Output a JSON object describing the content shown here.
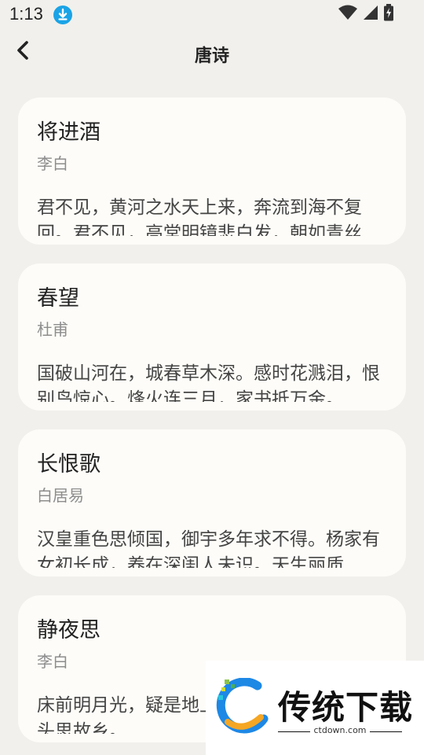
{
  "status_bar": {
    "time": "1:13",
    "icons": [
      "download-icon",
      "wifi-icon",
      "signal-icon",
      "battery-charging-icon"
    ],
    "colors": {
      "download": "#1aa3e6"
    }
  },
  "header": {
    "title": "唐诗",
    "back_icon": "chevron-left-icon"
  },
  "poems": [
    {
      "title": "将进酒",
      "author": "李白",
      "excerpt": "君不见，黄河之水天上来，奔流到海不复回。君不见，高堂明镜悲白发，朝如青丝"
    },
    {
      "title": "春望",
      "author": "杜甫",
      "excerpt": "国破山河在，城春草木深。感时花溅泪，恨别鸟惊心。烽火连三月，家书抵万金。"
    },
    {
      "title": "长恨歌",
      "author": "白居易",
      "excerpt": "汉皇重色思倾国，御宇多年求不得。杨家有女初长成，养在深闺人未识。天生丽质"
    },
    {
      "title": "静夜思",
      "author": "李白",
      "excerpt": "床前明月光，疑是地上霜。举头望明月，低头思故乡。"
    }
  ],
  "watermark": {
    "name": "传统下载",
    "url": "ctdown.com"
  },
  "colors": {
    "background": "#f1f0ec",
    "card": "#fdfcf8",
    "author_text": "#8d8d8d"
  }
}
